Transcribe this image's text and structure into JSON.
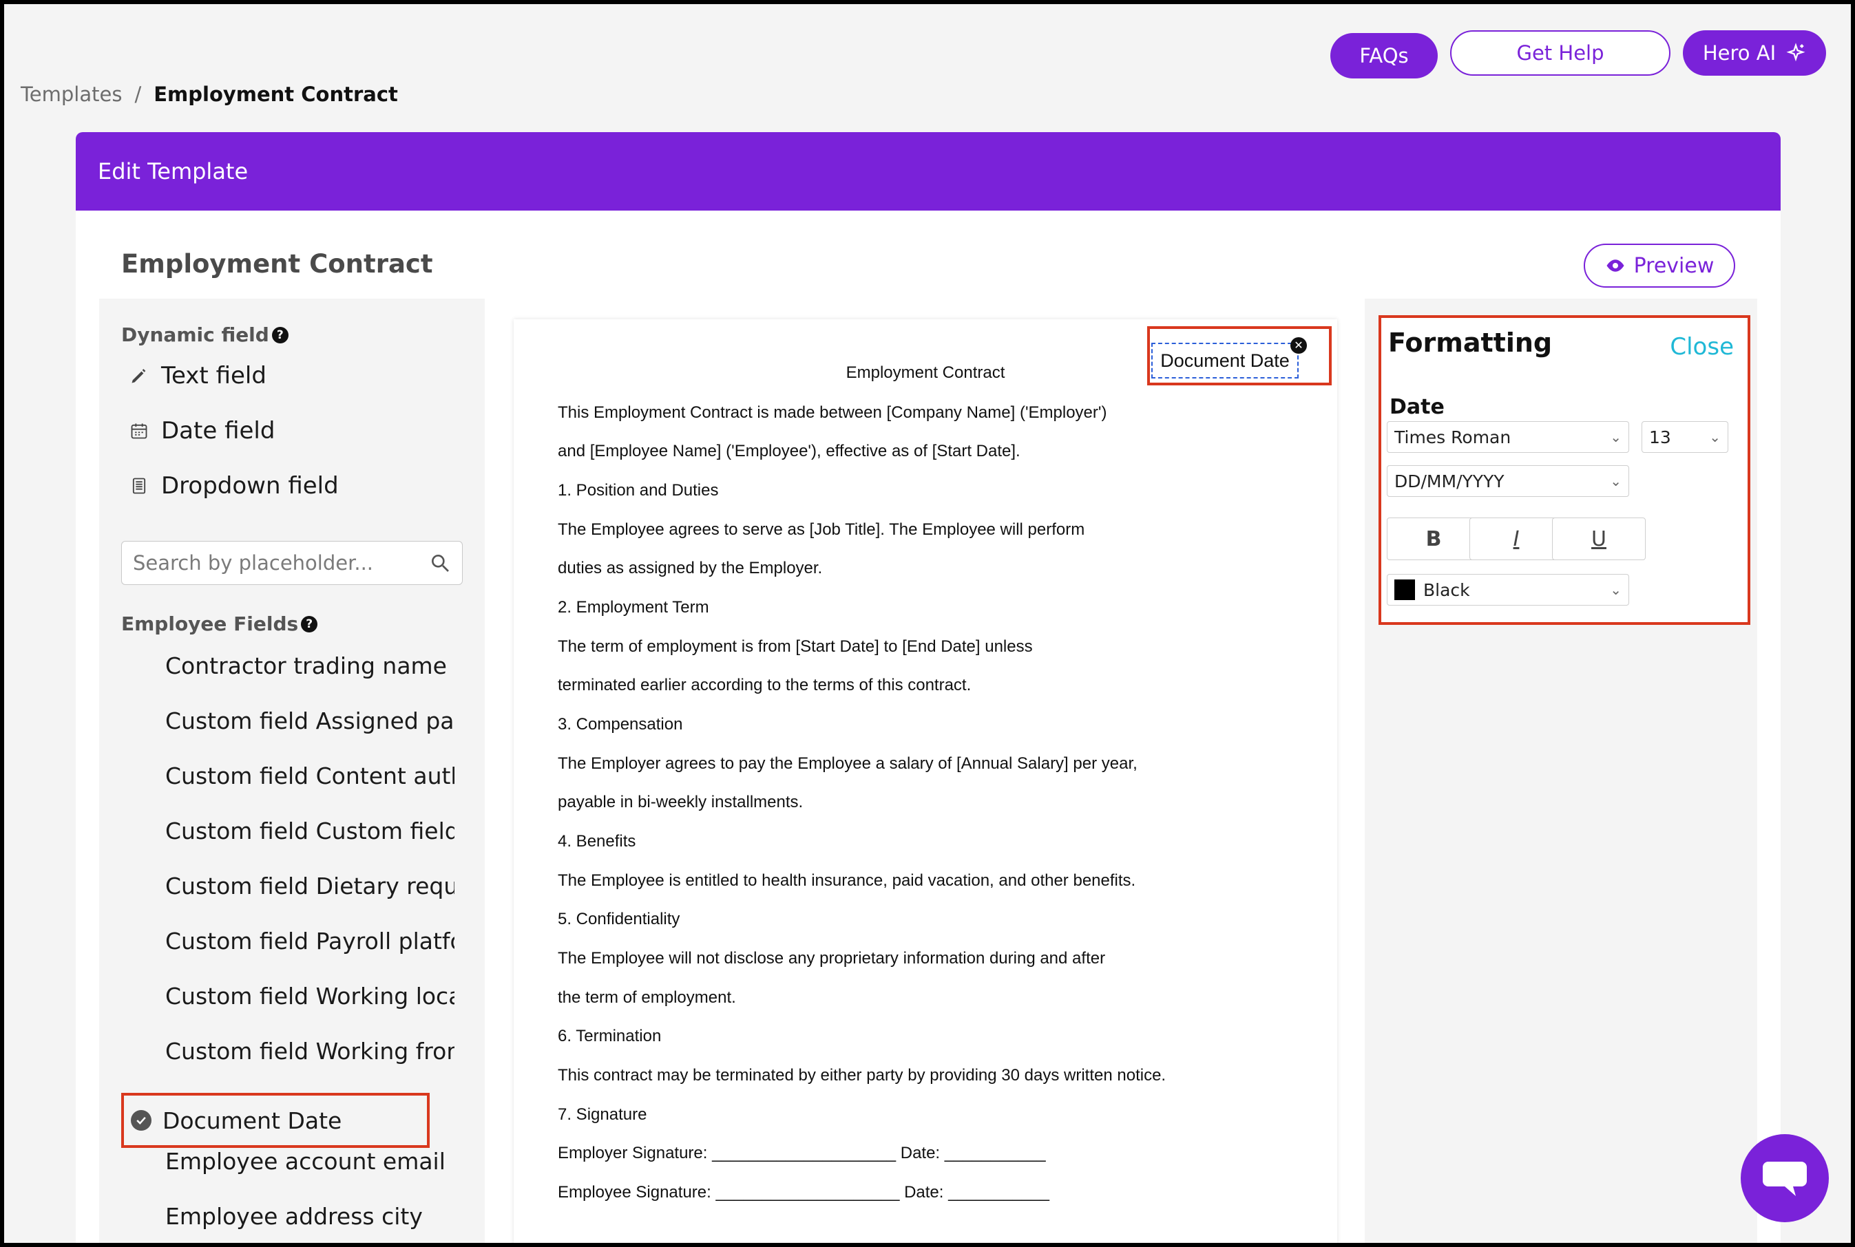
{
  "header": {
    "faq_label": "FAQs",
    "help_label": "Get Help",
    "hero_label": "Hero AI"
  },
  "breadcrumb": {
    "root": "Templates",
    "sep": "/",
    "current": "Employment Contract"
  },
  "card": {
    "header_title": "Edit Template",
    "doc_title": "Employment Contract",
    "preview_label": "Preview"
  },
  "sidebar": {
    "dynamic_label": "Dynamic field",
    "dynamic_items": [
      "Text field",
      "Date field",
      "Dropdown field"
    ],
    "search_placeholder": "Search by placeholder...",
    "employee_label": "Employee Fields",
    "employee_items": [
      "Contractor trading name",
      "Custom field Assigned parking",
      "Custom field Content author",
      "Custom field Custom field c",
      "Custom field Dietary requirements",
      "Custom field Payroll platform",
      "Custom field Working location",
      "Custom field Working from home",
      "Document Date",
      "Employee account email",
      "Employee address city"
    ],
    "selected_index": 8
  },
  "document": {
    "placed_field": "Document Date",
    "title": "Employment Contract",
    "lines": [
      "This Employment Contract is made between [Company Name] ('Employer')",
      "and [Employee Name] ('Employee'), effective as of [Start Date].",
      "1. Position and Duties",
      "The Employee agrees to serve as [Job Title]. The Employee will perform",
      "duties as assigned by the Employer.",
      "2. Employment Term",
      "The term of employment is from [Start Date] to [End Date] unless",
      "terminated earlier according to the terms of this contract.",
      "3. Compensation",
      "The Employer agrees to pay the Employee a salary of [Annual Salary] per year,",
      "payable in bi-weekly installments.",
      "4. Benefits",
      "The Employee is entitled to health insurance, paid vacation, and other benefits.",
      "5. Confidentiality",
      "The Employee will not disclose any proprietary information during and after",
      "the term of employment.",
      "6. Termination",
      "This contract may be terminated by either party by providing 30 days written notice.",
      "7. Signature",
      "Employer Signature: ____________________ Date: ___________",
      "Employee Signature: ____________________ Date: ___________"
    ]
  },
  "formatting": {
    "title": "Formatting",
    "close_label": "Close",
    "field_label": "Date",
    "font": "Times Roman",
    "size": "13",
    "date_format": "DD/MM/YYYY",
    "bold": "B",
    "italic": "I",
    "underline": "U",
    "color_name": "Black",
    "color_hex": "#000000"
  },
  "colors": {
    "brand": "#7a22d9",
    "highlight": "#d9381e",
    "link": "#1fb8d6"
  }
}
